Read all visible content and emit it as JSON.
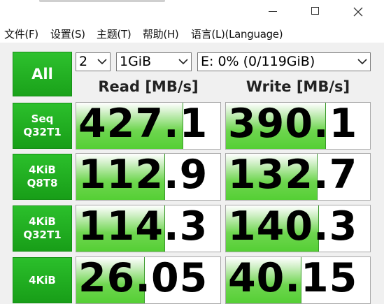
{
  "window": {
    "minimize_icon": "minimize-icon",
    "maximize_icon": "maximize-icon",
    "close_icon": "close-icon"
  },
  "menu": {
    "items": [
      "文件(F)",
      "设置(S)",
      "主题(T)",
      "帮助(H)",
      "语言(L)(Language)"
    ]
  },
  "controls": {
    "all_label": "All",
    "count_value": "2",
    "size_value": "1GiB",
    "drive_value": "E: 0% (0/119GiB)"
  },
  "headers": {
    "read": "Read [MB/s]",
    "write": "Write [MB/s]"
  },
  "rows": [
    {
      "label_line1": "Seq",
      "label_line2": "Q32T1",
      "read": "427.1",
      "write": "390.1",
      "read_fill": 0.74,
      "write_fill": 0.69
    },
    {
      "label_line1": "4KiB",
      "label_line2": "Q8T8",
      "read": "112.9",
      "write": "132.7",
      "read_fill": 0.61,
      "write_fill": 0.63
    },
    {
      "label_line1": "4KiB",
      "label_line2": "Q32T1",
      "read": "114.3",
      "write": "140.3",
      "read_fill": 0.61,
      "write_fill": 0.64
    },
    {
      "label_line1": "4KiB",
      "label_line2": "",
      "read": "26.05",
      "write": "40.15",
      "read_fill": 0.47,
      "write_fill": 0.52
    }
  ],
  "colors": {
    "accent_green": "#1aa21a",
    "bar_green": "#55cf35"
  }
}
